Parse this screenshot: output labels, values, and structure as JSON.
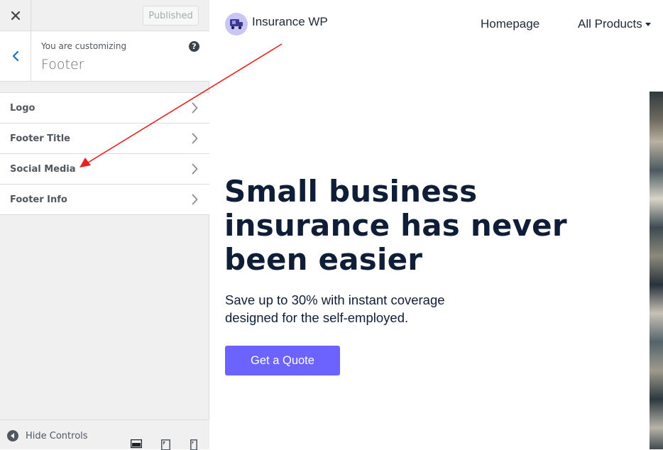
{
  "customizer": {
    "publish_label": "Published",
    "customizing_label": "You are customizing",
    "section_title": "Footer",
    "controls": [
      {
        "label": "Logo"
      },
      {
        "label": "Footer Title"
      },
      {
        "label": "Social Media"
      },
      {
        "label": "Footer Info"
      }
    ],
    "hide_controls_label": "Hide Controls"
  },
  "preview": {
    "brand_name": "Insurance WP",
    "nav": {
      "home": "Homepage",
      "products": "All Products"
    },
    "hero": {
      "title": "Small business insurance has never been easier",
      "subtitle": "Save up to 30% with instant coverage designed for the self-employed.",
      "cta": "Get a Quote"
    }
  },
  "colors": {
    "accent": "#6c63ff",
    "annotation_arrow": "#e8231f",
    "heading": "#0f1e36"
  },
  "icons": {
    "close": "close-icon",
    "back": "chevron-left-icon",
    "help": "help-icon",
    "chevron": "chevron-right-icon",
    "hide_controls": "arrow-left-circle-icon",
    "devices": [
      "desktop-icon",
      "tablet-icon",
      "mobile-icon"
    ]
  }
}
